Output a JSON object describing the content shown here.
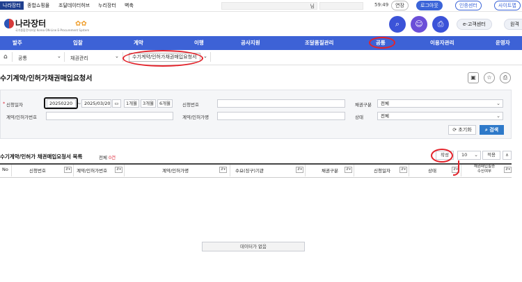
{
  "topbar": {
    "links": [
      "나라장터",
      "종합쇼핑몰",
      "조달데이터허브",
      "누리장터",
      "벽축"
    ],
    "search_value": "님",
    "clock": "59:49",
    "extend": "연장",
    "logout": "로그아웃",
    "cert_center": "인증센터",
    "sitemap": "사이트맵"
  },
  "header": {
    "logo_title": "나라장터",
    "logo_subtitle": "국가종합전자조달 Korea ON-Line E-Procurement System",
    "flower": "✿✿",
    "search_icon": "⌕",
    "user_icon": "☺",
    "print_icon": "⎙",
    "customer_center": "e-고객센터",
    "remote": "원격"
  },
  "nav": [
    "발주",
    "입찰",
    "계약",
    "이행",
    "공사지원",
    "조달품질관리",
    "공통",
    "이용자관리",
    "운영자"
  ],
  "breadcrumb": {
    "home_icon": "⌂",
    "level1": "공통",
    "level2": "채권관리",
    "level3": "수기계약/인허가채권매입요청서",
    "chevron": "⌄"
  },
  "page": {
    "title": "수기계약/인허가채권매입요청서",
    "tool_icons": [
      "▣",
      "☆",
      "⎙"
    ]
  },
  "search": {
    "req_mark": "*",
    "date_label": "신청일자",
    "date_from": "20250220",
    "date_sep": "~",
    "date_to": "2025/03/20",
    "cal_icon": "▭",
    "period_buttons": [
      "1개월",
      "3개월",
      "6개월"
    ],
    "apply_no_label": "신청번호",
    "bond_type_label": "채권구분",
    "bond_type_value": "전체",
    "contract_no_label": "계약/인허가번호",
    "contract_name_label": "계약/인허가명",
    "status_label": "상태",
    "status_value": "전체",
    "reset_label": "⟳ 초기화",
    "search_label": "⌕ 검색"
  },
  "list": {
    "title": "수기계약/인허가 채권매입요청서 목록",
    "count_prefix": "전체",
    "count_value": "0건",
    "create_button": "작성",
    "page_size": "10",
    "apply_button": "적용",
    "collapse_icon": "∧",
    "columns": [
      "No",
      "신청번호",
      "계약/인허가번호",
      "계약/인허가명",
      "수요(징구)기관",
      "채권구분",
      "신청일자",
      "상태"
    ],
    "last_column": [
      "채권매입필증",
      "수신여부"
    ],
    "sort_glyph": "⇵▾",
    "no_data": "데이터가 없음"
  },
  "colors": {
    "nav_blue": "#3d62d6",
    "button_blue": "#2e79c9",
    "annotation_red": "#e3232b"
  }
}
